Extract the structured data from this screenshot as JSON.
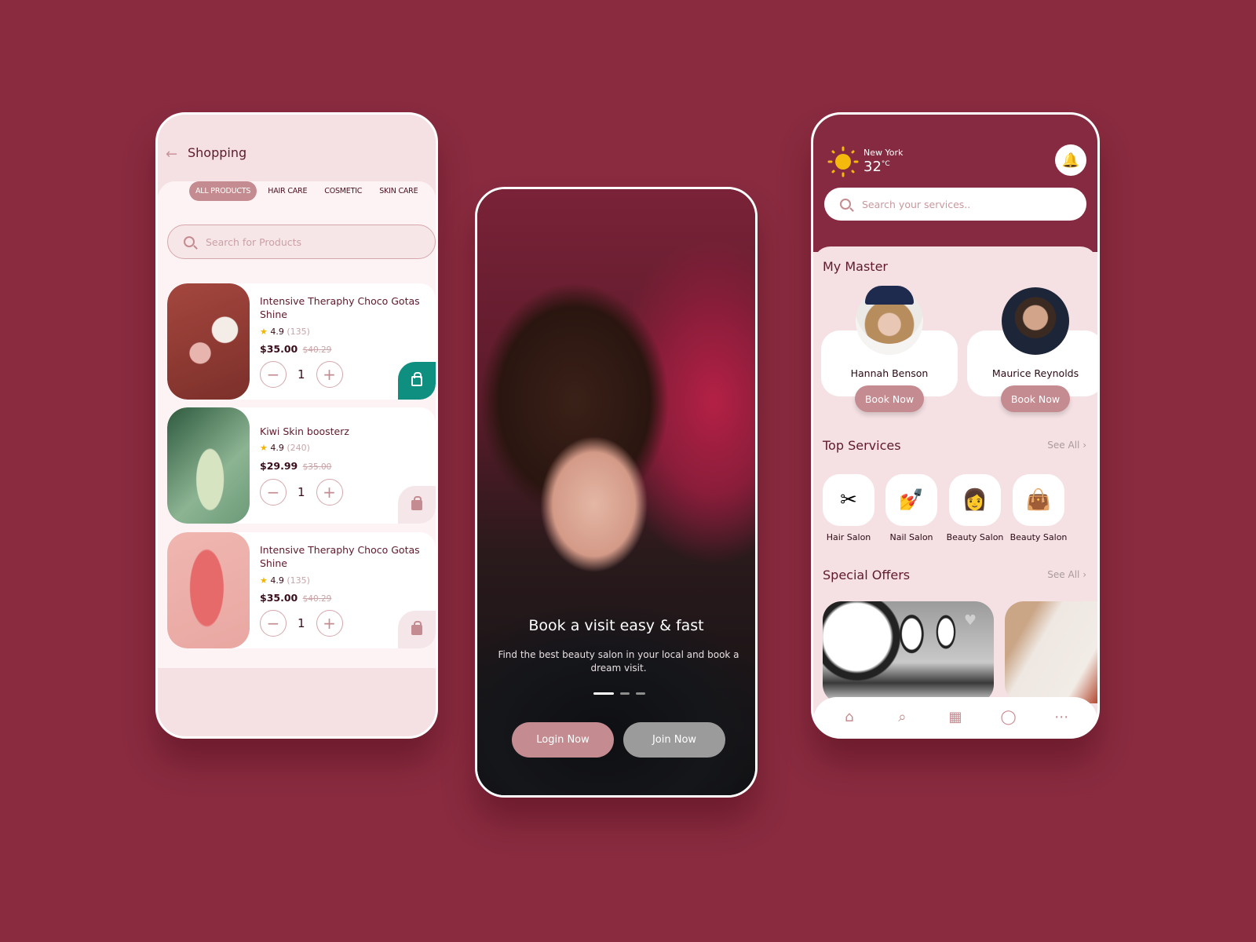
{
  "shopping": {
    "title": "Shopping",
    "back_icon": "arrow-left-icon",
    "tabs": [
      {
        "label": "ALL PRODUCTS",
        "active": true
      },
      {
        "label": "HAIR CARE",
        "active": false
      },
      {
        "label": "COSMETIC",
        "active": false
      },
      {
        "label": "SKIN CARE",
        "active": false
      }
    ],
    "search_placeholder": "Search for Products",
    "products": [
      {
        "name": "Intensive Theraphy Choco Gotas Shine",
        "rating": "4.9",
        "reviews": "(135)",
        "price": "$35.00",
        "old_price": "$40.29",
        "qty": "1",
        "in_cart": true
      },
      {
        "name": "Kiwi Skin boosterz",
        "rating": "4.9",
        "reviews": "(240)",
        "price": "$29.99",
        "old_price": "$35.00",
        "qty": "1",
        "in_cart": false
      },
      {
        "name": "Intensive Theraphy Choco Gotas Shine",
        "rating": "4.9",
        "reviews": "(135)",
        "price": "$35.00",
        "old_price": "$40.29",
        "qty": "1",
        "in_cart": false
      }
    ],
    "minus": "−",
    "plus": "+",
    "star": "★"
  },
  "onboarding": {
    "title": "Book a visit easy & fast",
    "subtitle": "Find the best beauty salon in your local and book a dream visit.",
    "slides": 3,
    "active_slide": 1,
    "login_label": "Login Now",
    "join_label": "Join Now"
  },
  "home": {
    "city": "New York",
    "temperature": "32",
    "unit": "°C",
    "search_placeholder": "Search your services..",
    "masters_title": "My Master",
    "masters": [
      {
        "name": "Hannah Benson",
        "book_label": "Book Now"
      },
      {
        "name": "Maurice Reynolds",
        "book_label": "Book Now"
      }
    ],
    "services_title": "Top Services",
    "see_all": "See All",
    "services": [
      {
        "label": "Hair Salon",
        "icon": "✂"
      },
      {
        "label": "Nail Salon",
        "icon": "💅"
      },
      {
        "label": "Beauty Salon",
        "icon": "👩"
      },
      {
        "label": "Beauty Salon",
        "icon": "👜"
      }
    ],
    "offers_title": "Special Offers",
    "nav": [
      {
        "name": "home",
        "icon": "⌂"
      },
      {
        "name": "search",
        "icon": "⌕"
      },
      {
        "name": "calendar",
        "icon": "▦"
      },
      {
        "name": "chat",
        "icon": "◯"
      },
      {
        "name": "more",
        "icon": "⋯"
      }
    ]
  },
  "colors": {
    "background": "#8a2b40",
    "accent": "#c48b90",
    "cart_active": "#0f8f7f",
    "header": "#852a40"
  }
}
